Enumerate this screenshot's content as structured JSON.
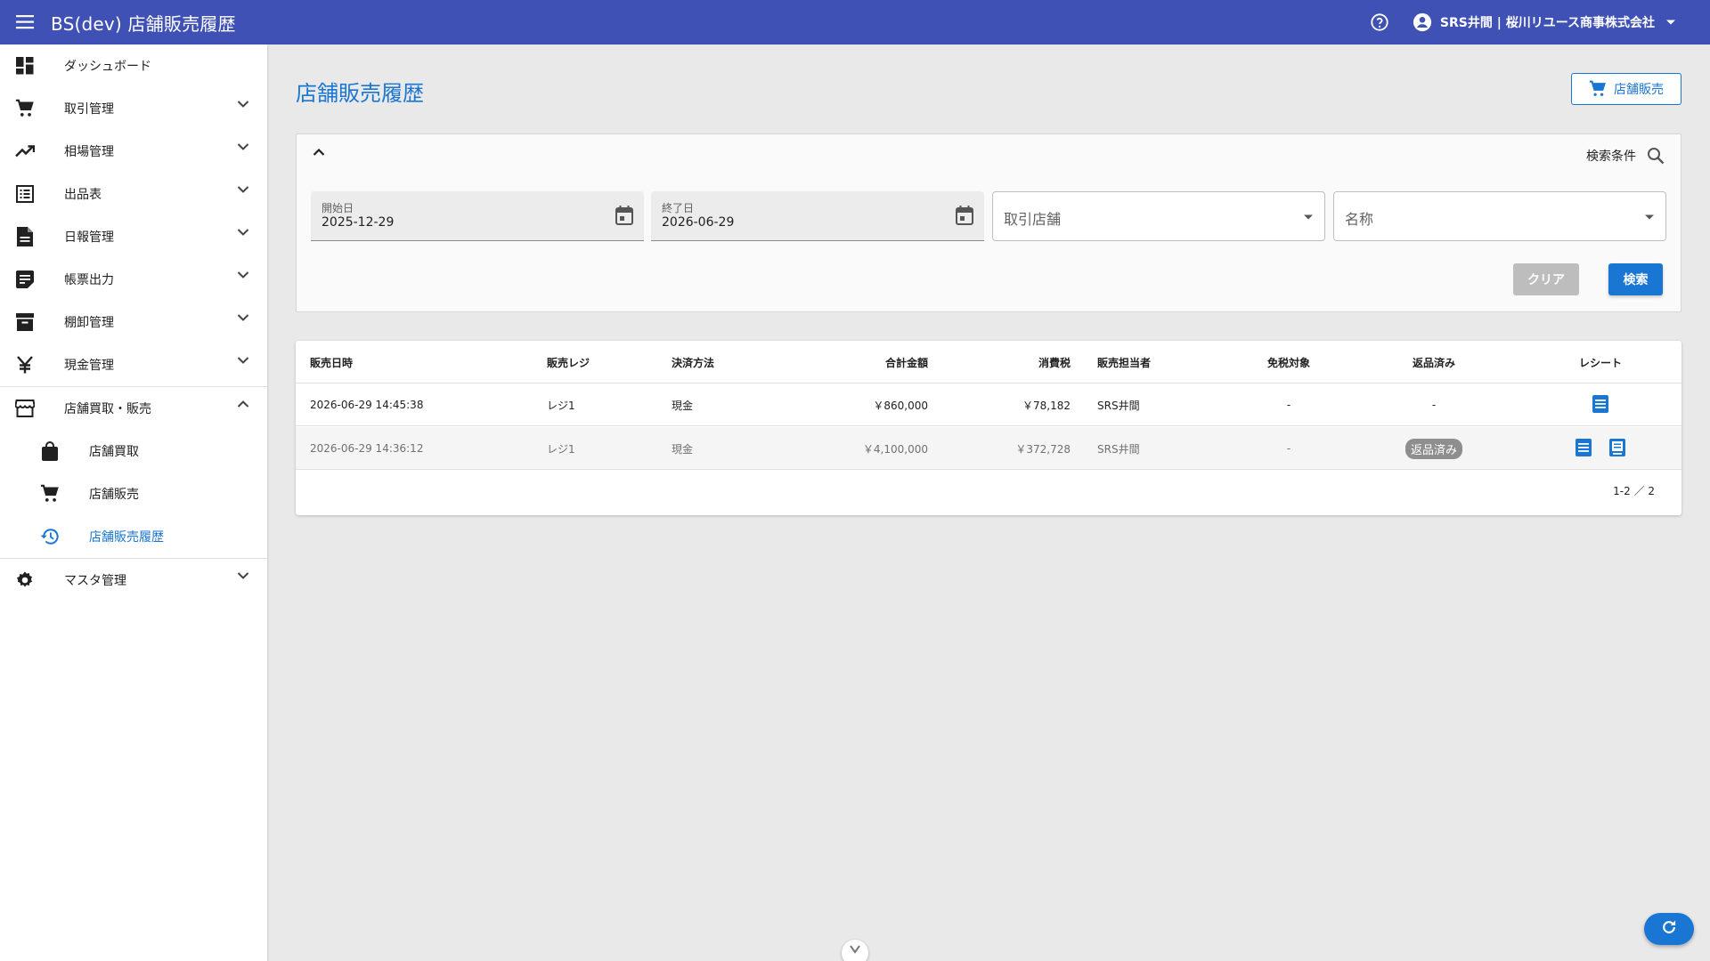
{
  "appbar": {
    "title": "BS(dev) 店舗販売履歴",
    "user_label": "SRS井間 | 桜川リユース商事株式会社",
    "color": "#3f51b5"
  },
  "sidebar": {
    "items": [
      {
        "label": "ダッシュボード",
        "icon": "dashboard-icon"
      },
      {
        "label": "取引管理",
        "icon": "cart-icon"
      },
      {
        "label": "相場管理",
        "icon": "trending-up-icon"
      },
      {
        "label": "出品表",
        "icon": "list-icon"
      },
      {
        "label": "日報管理",
        "icon": "document-icon"
      },
      {
        "label": "帳票出力",
        "icon": "note-icon"
      },
      {
        "label": "棚卸管理",
        "icon": "archive-icon"
      },
      {
        "label": "現金管理",
        "icon": "yen-icon"
      },
      {
        "label": "店舗買取・販売",
        "icon": "store-icon"
      }
    ],
    "sub_items": [
      {
        "label": "店舗買取",
        "icon": "bag-icon"
      },
      {
        "label": "店舗販売",
        "icon": "cart-icon"
      },
      {
        "label": "店舗販売履歴",
        "icon": "history-icon"
      }
    ],
    "master": {
      "label": "マスタ管理",
      "icon": "gear-icon"
    }
  },
  "page": {
    "title": "店舗販売履歴",
    "action_button": "店舗販売"
  },
  "search": {
    "heading": "検索条件",
    "start_label": "開始日",
    "start_value": "2025-12-29",
    "end_label": "終了日",
    "end_value": "2026-06-29",
    "store_placeholder": "取引店舗",
    "name_placeholder": "名称",
    "clear_label": "クリア",
    "search_label": "検索"
  },
  "table": {
    "headers": {
      "date": "販売日時",
      "register": "販売レジ",
      "payment": "決済方法",
      "total": "合計金額",
      "tax": "消費税",
      "staff": "販売担当者",
      "tax_free": "免税対象",
      "returned": "返品済み",
      "receipt": "レシート"
    },
    "rows": [
      {
        "date": "2026-06-29 14:45:38",
        "register": "レジ1",
        "payment": "現金",
        "total": "￥860,000",
        "tax": "￥78,182",
        "staff": "SRS井間",
        "tax_free": "-",
        "returned": "-"
      },
      {
        "date": "2026-06-29 14:36:12",
        "register": "レジ1",
        "payment": "現金",
        "total": "￥4,100,000",
        "tax": "￥372,728",
        "staff": "SRS井間",
        "tax_free": "-",
        "returned": "返品済み"
      }
    ],
    "pagination": "1-2 ／ 2"
  }
}
